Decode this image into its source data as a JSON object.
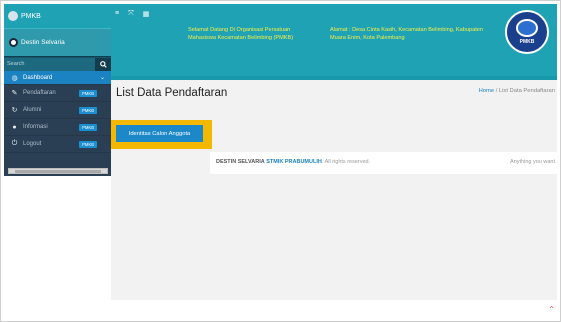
{
  "sidebar": {
    "brand": "PMKB",
    "user_name": "Destin Selvaria",
    "search_placeholder": "Search",
    "items": [
      {
        "label": "Dashboard",
        "icon": "dashboard-icon",
        "active": true
      },
      {
        "label": "Pendaftaran",
        "icon": "key-icon",
        "badge": "PMKB"
      },
      {
        "label": "Alumni",
        "icon": "refresh-icon",
        "badge": "PMKB"
      },
      {
        "label": "Informasi",
        "icon": "info-icon",
        "badge": "PMKB"
      },
      {
        "label": "Logout",
        "icon": "power-icon",
        "badge": "PMKB"
      }
    ]
  },
  "header": {
    "greeting": "Selamat Datang Di Organisasi Persatuan Mahasiswa Kecamatan Belimbing (PMKB)",
    "address": "Alamat : Desa Cinta Kasih, Kecamatan Belimbing, Kabupaten Muara Enim, Kota Palembang",
    "emblem_text": "PMKB"
  },
  "main": {
    "title": "List Data Pendaftaran",
    "breadcrumb": {
      "home": "Home",
      "separator": " / ",
      "current": "List Data Pendaftaran"
    },
    "button_label": "Identitas Calon Anggota"
  },
  "footer": {
    "name": "DESTIN SELVARIA",
    "org": "STMIK PRABUMULIH",
    "rights": ". All rights reserved.",
    "right_text": "Anything you want"
  },
  "colors": {
    "header": "#1fa2b4",
    "sidebar": "#2a3f54",
    "accent": "#1c88c7",
    "highlight": "#f5b800",
    "header_text": "#f3ef4a"
  }
}
